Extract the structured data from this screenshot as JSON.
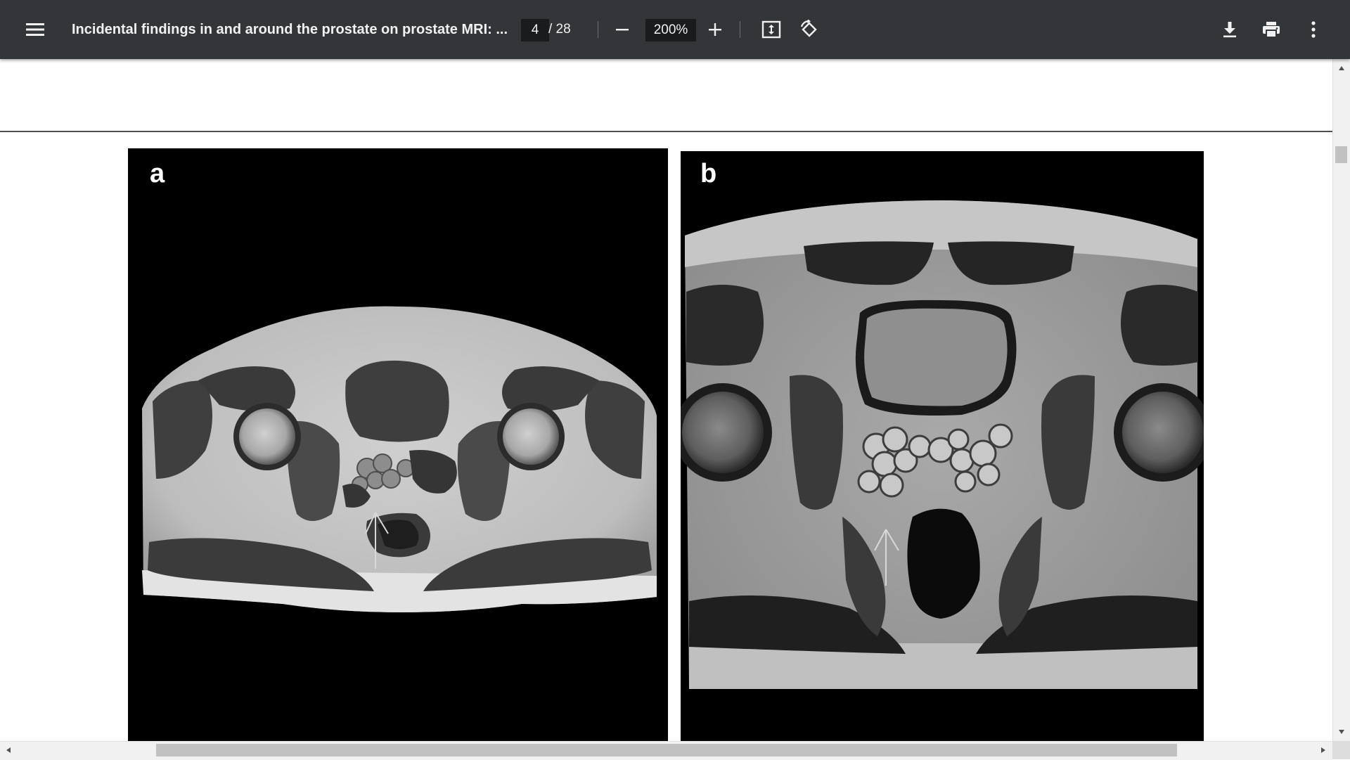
{
  "toolbar": {
    "menu_icon": "hamburger-menu-icon",
    "title": "Incidental findings in and around the prostate on prostate MRI: ...",
    "page_current": "4",
    "page_total": "/ 28",
    "zoom_out_icon": "minus-icon",
    "zoom_value": "200%",
    "zoom_in_icon": "plus-icon",
    "fit_icon": "fit-to-page-icon",
    "rotate_icon": "rotate-icon",
    "download_icon": "download-icon",
    "print_icon": "print-icon",
    "more_icon": "more-vertical-icon"
  },
  "document": {
    "figure": {
      "panel_a_label": "a",
      "panel_b_label": "b"
    }
  },
  "colors": {
    "toolbar_bg": "#323639",
    "toolbar_text": "#f1f1f1",
    "viewer_bg": "#ffffff",
    "scrollbar_thumb": "#c1c1c1"
  }
}
